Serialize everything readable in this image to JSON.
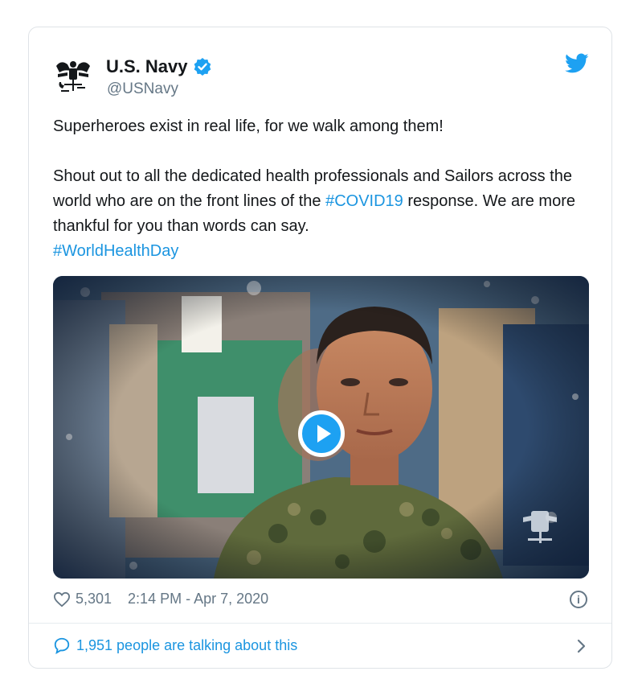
{
  "tweet": {
    "name": "U.S. Navy",
    "handle": "@USNavy",
    "verified": true,
    "text_line1": "Superheroes exist in real life, for we walk among them!",
    "text_p2_a": "Shout out to all the dedicated health professionals and Sailors across the world who are on the front lines of the ",
    "hashtag1": "#COVID19",
    "text_p2_b": " response. We are more thankful for you than words can say.",
    "hashtag2": "#WorldHealthDay",
    "likes": "5,301",
    "time": "2:14 PM - Apr 7, 2020",
    "talking": "1,951 people are talking about this"
  },
  "icons": {
    "avatar": "us-navy-eagle-logo",
    "verified": "verified-badge-icon",
    "twitter": "twitter-bird-icon",
    "like": "heart-icon",
    "info": "info-icon",
    "reply": "speech-bubble-icon",
    "next": "chevron-right-icon",
    "play": "play-icon"
  },
  "colors": {
    "link": "#1b95e0",
    "muted": "#657786",
    "brand": "#1da1f2",
    "text": "#14171a"
  }
}
